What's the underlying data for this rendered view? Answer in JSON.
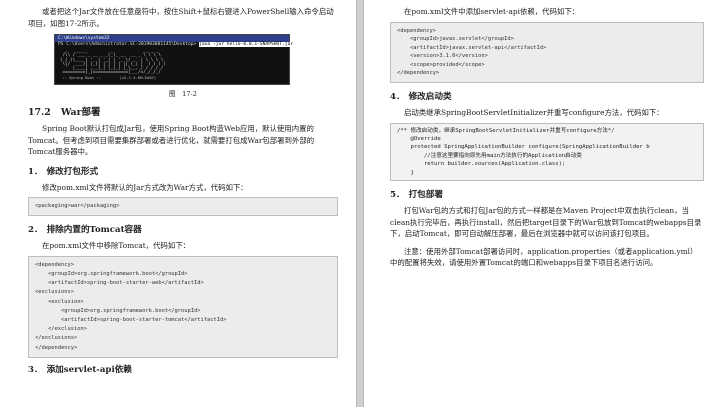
{
  "left": {
    "intro": "或者把这个Jar文件放在任意盘符中，按住Shift+鼠标右键进入PowerShell输入命令启动项目，如图17-2所示。",
    "figure": {
      "window_title": "C:\\Windows\\system32",
      "prompt": "PS C:\\Users\\Administrator.SC-201903081145\\Desktop> ",
      "command": "java -jar hello-0.0.1-SNAPSHOT.jar",
      "ascii_art": [
        "  .   ____          _            __ _ _",
        " /\\\\ / ___'_ __ _ _(_)_ __  __ _ \\ \\ \\ \\",
        "( ( )\\___ | '_ | '_| | '_ \\/ _` | \\ \\ \\ \\",
        " \\\\/  ___)| |_)| | | | | || (_| |  ) ) ) )",
        "  '  |____| .__|_| |_|_| |_\\__, | / / / /",
        " =========|_|==============|___/=/_/_/_/"
      ],
      "version_line": " :: Spring Boot ::        (v2.1.3.RELEASE)",
      "caption": "图　17-2"
    },
    "section": {
      "num": "17.2",
      "title": "War部署"
    },
    "section_para": "Spring Boot默认打包成Jar包，使用Spring Boot构造Web应用，默认使用内置的Tomcat。但考虑到项目需要集群部署或者进行优化，就需要打包成War包部署到外部的Tomcat服务器中。",
    "s1": {
      "num": "1．",
      "title": "修改打包形式"
    },
    "s1_para": "修改pom.xml文件将默认的Jar方式改为War方式，代码如下：",
    "s1_code": [
      "<packaging>war</packaging>"
    ],
    "s2": {
      "num": "2．",
      "title": "排除内置的Tomcat容器"
    },
    "s2_para": "在pom.xml文件中移除Tomcat，代码如下：",
    "s2_code": [
      "<dependency>",
      "    <groupId>org.springframework.boot</groupId>",
      "    <artifactId>spring-boot-starter-web</artifactId>",
      "<exclusions>",
      "    <exclusion>",
      "        <groupId>org.springframework.boot</groupId>",
      "        <artifactId>spring-boot-starter-tomcat</artifactId>",
      "    </exclusion>",
      "</exclusions>",
      "</dependency>"
    ],
    "s3": {
      "num": "3．",
      "title": "添加servlet-api依赖"
    }
  },
  "right": {
    "top_para": "在pom.xml文件中添加servlet-api依赖，代码如下：",
    "top_code": [
      "<dependency>",
      "    <groupId>javax.servlet</groupId>",
      "    <artifactId>javax.servlet-api</artifactId>",
      "    <version>3.1.0</version>",
      "    <scope>provided</scope>",
      "</dependency>"
    ],
    "s4": {
      "num": "4．",
      "title": "修改启动类"
    },
    "s4_para": "启动类继承SpringBootServletInitializer并重写configure方法，代码如下：",
    "s4_code": [
      "/** 修改启动类，继承SpringBootServletInitializer并重写configure方法*/",
      "    @Override",
      "    protected SpringApplicationBuilder configure(SpringApplicationBuilder b",
      "        //注意这里要指向原先用main方法执行的Application启动类",
      "        return builder.sources(Application.class);",
      "    }"
    ],
    "s5": {
      "num": "5．",
      "title": "打包部署"
    },
    "s5_para1": "打包War包的方式和打包Jar包的方式一样都是在Maven Project中双击执行clean，当clean执行完毕后，再执行install，然后把target目录下的War包放到Tomcat的webapps目录下，启动Tomcat，即可自动解压部署，最后在浏览器中就可以访问该打包项目。",
    "s5_para2": "注意：使用外部Tomcat部署访问时，application.properties（或者application.yml）中的配置将失效，请使用外置Tomcat的端口和webapps目录下项目名进行访问。"
  }
}
